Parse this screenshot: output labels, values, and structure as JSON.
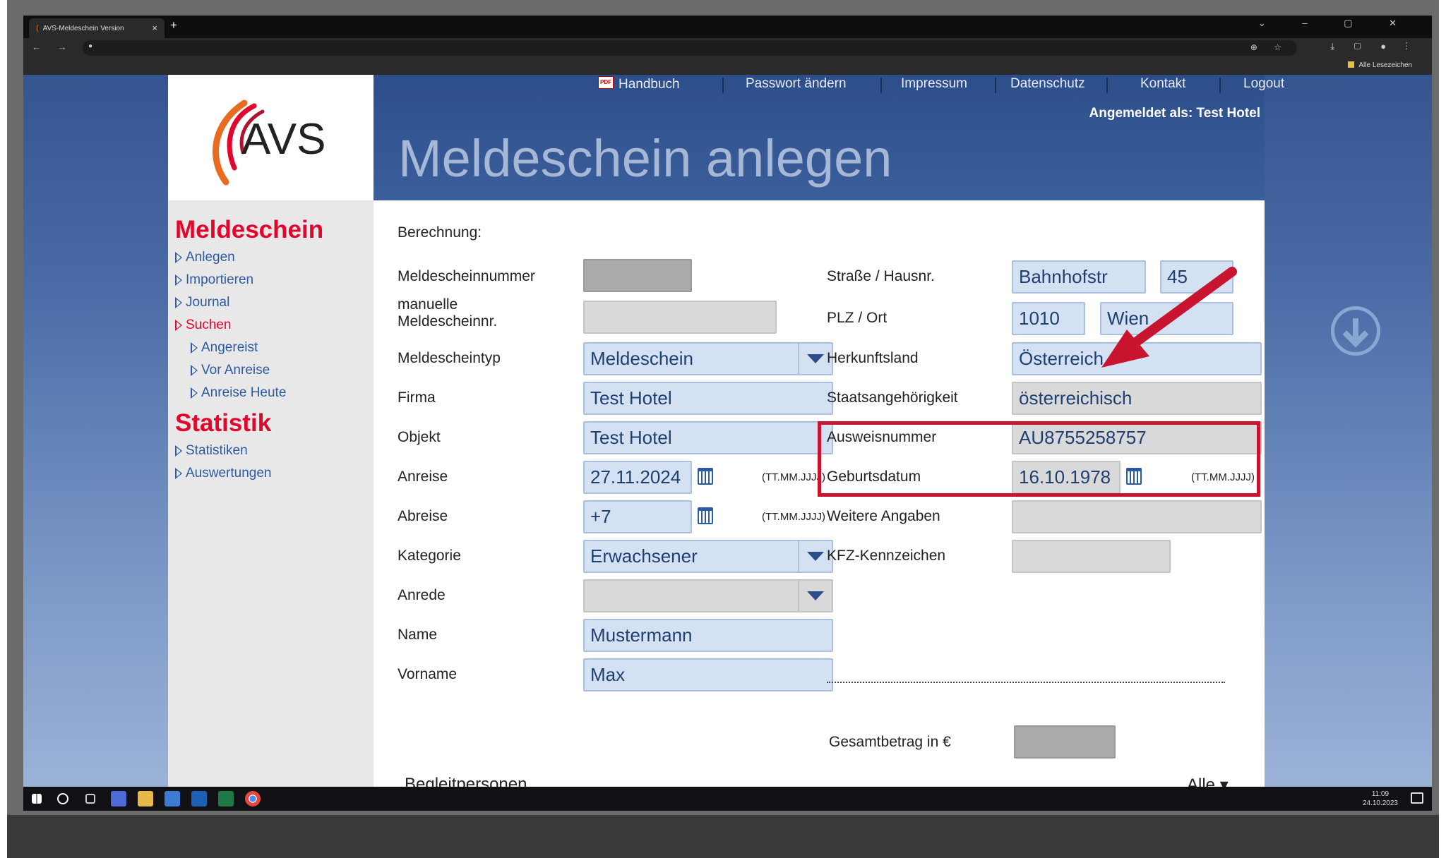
{
  "browser": {
    "tab_title": "AVS-Meldeschein Version",
    "tab_close": "×",
    "new_tab": "+",
    "window_buttons": "⌄ – ▢ ✕",
    "nav_buttons": "← → C",
    "address_icons": "⊕ ☆",
    "toolbar_icons": "⤓ ▢ ● ⋮",
    "bookmarks_label": "Alle Lesezeichen"
  },
  "topnav": {
    "pdf_badge": "PDF",
    "handbuch": "Handbuch",
    "passwort": "Passwort ändern",
    "impressum": "Impressum",
    "datenschutz": "Datenschutz",
    "kontakt": "Kontakt",
    "logout": "Logout"
  },
  "logged_in": "Angemeldet als: Test Hotel",
  "page_title": "Meldeschein anlegen",
  "logo_text": "AVS",
  "sidebar": {
    "section1": "Meldeschein",
    "anlegen": "Anlegen",
    "importieren": "Importieren",
    "journal": "Journal",
    "suchen": "Suchen",
    "angereist": "Angereist",
    "vor_anreise": "Vor Anreise",
    "anreise_heute": "Anreise Heute",
    "section2": "Statistik",
    "statistiken": "Statistiken",
    "auswertungen": "Auswertungen"
  },
  "form": {
    "berechnung": "Berechnung:",
    "meldescheinnummer_label": "Meldescheinnummer",
    "manuelle_label": "manuelle\nMeldescheinnr.",
    "typ_label": "Meldescheintyp",
    "typ_value": "Meldeschein",
    "firma_label": "Firma",
    "firma_value": "Test Hotel",
    "objekt_label": "Objekt",
    "objekt_value": "Test Hotel",
    "anreise_label": "Anreise",
    "anreise_value": "27.11.2024",
    "date_format": "(TT.MM.JJJJ)",
    "abreise_label": "Abreise",
    "abreise_value": "+7",
    "kategorie_label": "Kategorie",
    "kategorie_value": "Erwachsener",
    "anrede_label": "Anrede",
    "name_label": "Name",
    "name_value": "Mustermann",
    "vorname_label": "Vorname",
    "vorname_value": "Max",
    "strasse_label": "Straße / Hausnr.",
    "strasse_value": "Bahnhofstr",
    "hausnr_value": "45",
    "plz_label": "PLZ / Ort",
    "plz_value": "1010",
    "ort_value": "Wien",
    "herkunft_label": "Herkunftsland",
    "herkunft_value": "Österreich",
    "staat_label": "Staatsangehörigkeit",
    "staat_value": "österreichisch",
    "ausweis_label": "Ausweisnummer",
    "ausweis_value": "AU8755258757",
    "geburt_label": "Geburtsdatum",
    "geburt_value": "16.10.1978",
    "weitere_label": "Weitere Angaben",
    "kfz_label": "KFZ-Kennzeichen",
    "gesamt_label": "Gesamtbetrag in €",
    "begleit_label": "Begleitpersonen",
    "alle_label": "Alle ▾"
  },
  "taskbar": {
    "time": "11:09",
    "date": "24.10.2023"
  },
  "colors": {
    "accent_red": "#e3062c",
    "link_blue": "#2d5aa0",
    "header_blue": "#2d4e8a",
    "field_blue": "#d4e1f2",
    "highlight_red": "#c8142e"
  }
}
